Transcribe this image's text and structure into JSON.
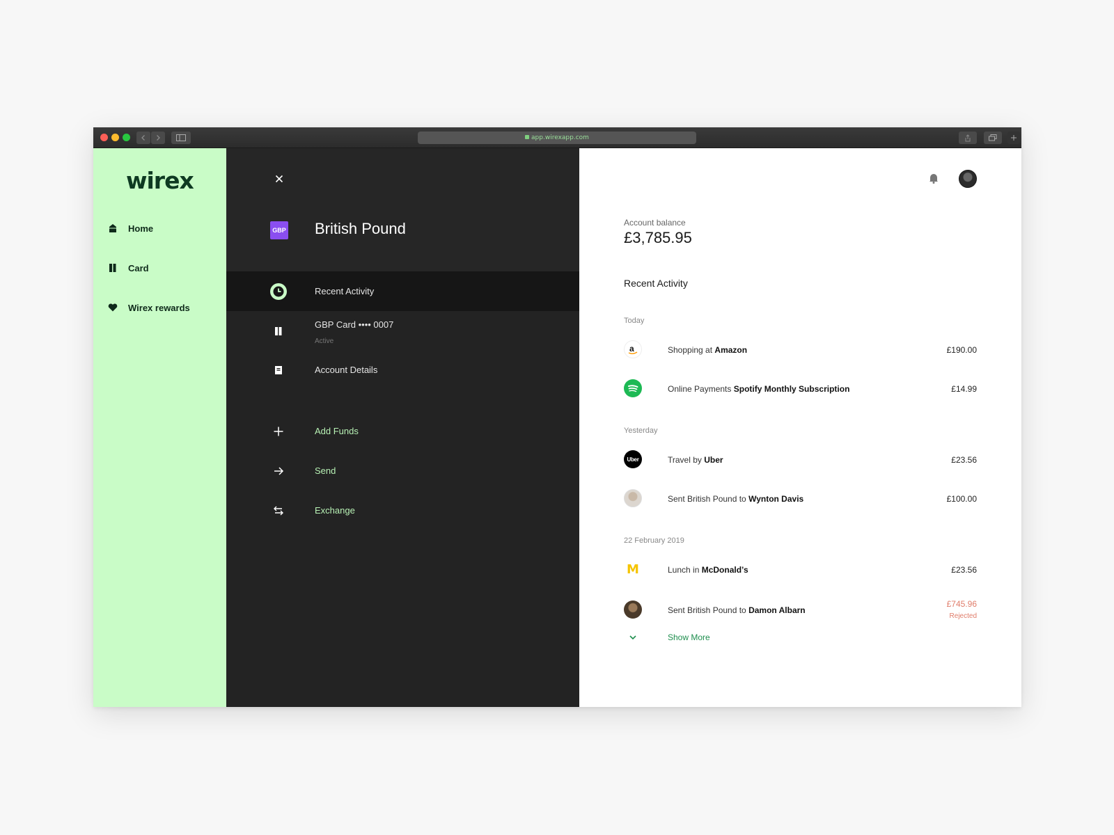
{
  "browser": {
    "url": "app.wirexapp.com"
  },
  "sidebar": {
    "logo": "wirex",
    "items": [
      {
        "label": "Home",
        "icon": "home-icon"
      },
      {
        "label": "Card",
        "icon": "card-icon"
      },
      {
        "label": "Wirex rewards",
        "icon": "heart-icon"
      }
    ]
  },
  "panel": {
    "currency_code": "GBP",
    "title": "British Pound",
    "menu": [
      {
        "label": "Recent Activity",
        "icon": "clock-icon",
        "active": true
      },
      {
        "label": "GBP Card •••• 0007",
        "sub": "Active",
        "icon": "card-icon"
      },
      {
        "label": "Account Details",
        "icon": "document-icon"
      },
      {
        "label": "Add Funds",
        "icon": "plus-icon"
      },
      {
        "label": "Send",
        "icon": "arrow-right-icon"
      },
      {
        "label": "Exchange",
        "icon": "exchange-icon"
      }
    ]
  },
  "content": {
    "balance_label": "Account balance",
    "balance_value": "£3,785.95",
    "section_title": "Recent Activity",
    "groups": [
      {
        "day": "Today",
        "items": [
          {
            "prefix": "Shopping at",
            "merchant": "Amazon",
            "amount": "£190.00",
            "logo": "amazon-logo"
          },
          {
            "prefix": "Online Payments",
            "merchant": "Spotify Monthly Subscription",
            "amount": "£14.99",
            "logo": "spotify-logo"
          }
        ]
      },
      {
        "day": "Yesterday",
        "items": [
          {
            "prefix": "Travel by",
            "merchant": "Uber",
            "amount": "£23.56",
            "logo": "uber-logo",
            "logo_text": "Uber"
          },
          {
            "prefix": "Sent British Pound to",
            "merchant": "Wynton Davis",
            "amount": "£100.00",
            "logo": "avatar"
          }
        ]
      },
      {
        "day": "22 February 2019",
        "items": [
          {
            "prefix": "Lunch in",
            "merchant": "McDonald’s",
            "amount": "£23.56",
            "logo": "mcdonalds-logo",
            "logo_text": "M"
          },
          {
            "prefix": "Sent British Pound to",
            "merchant": "Damon Albarn",
            "amount": "£745.96",
            "status": "Rejected",
            "logo": "avatar"
          }
        ]
      }
    ],
    "show_more": "Show More"
  },
  "colors": {
    "sidebar_bg": "#c9fcc7",
    "panel_bg": "#232323",
    "accent_green": "#1e8e4e",
    "rejected": "#e07c6a",
    "gbp_badge": "#8a4ef0"
  }
}
